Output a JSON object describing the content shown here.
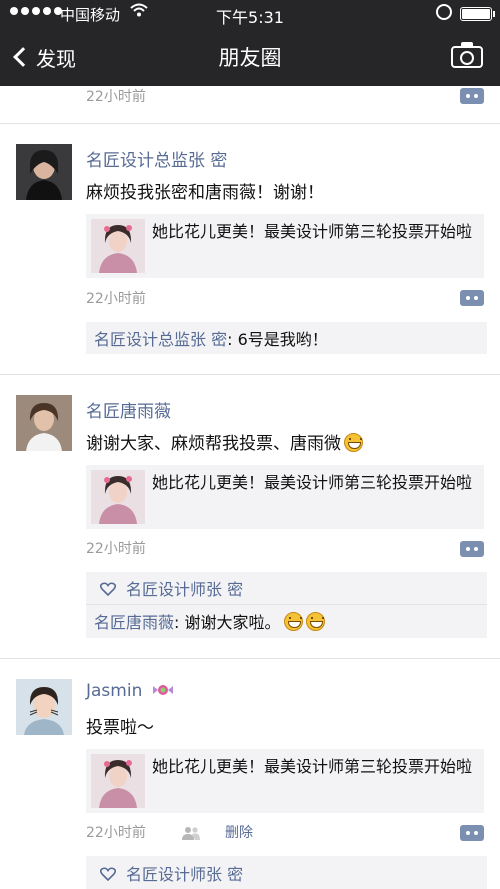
{
  "status_bar": {
    "carrier": "中国移动",
    "time": "下午5:31"
  },
  "nav": {
    "back_label": "发现",
    "title": "朋友圈"
  },
  "top_partial": {
    "time": "22小时前"
  },
  "posts": [
    {
      "author": "名匠设计总监张 密",
      "text": "麻烦投我张密和唐雨薇！谢谢！",
      "share_title": "她比花儿更美！最美设计师第三轮投票开始啦",
      "time": "22小时前",
      "comments": [
        {
          "author": "名匠设计总监张 密",
          "text": ": 6号是我哟！"
        }
      ]
    },
    {
      "author": "名匠唐雨薇",
      "text": "谢谢大家、麻烦帮我投票、唐雨微",
      "share_title": "她比花儿更美！最美设计师第三轮投票开始啦",
      "time": "22小时前",
      "likes": "名匠设计师张 密",
      "comments": [
        {
          "author": "名匠唐雨薇",
          "text": ": 谢谢大家啦。"
        }
      ]
    },
    {
      "author": "Jasmin",
      "text": "投票啦～",
      "share_title": "她比花儿更美！最美设计师第三轮投票开始啦",
      "time": "22小时前",
      "delete_label": "删除",
      "likes": "名匠设计师张 密"
    }
  ],
  "icons": {
    "back": "chevron-left-icon",
    "camera": "camera-icon",
    "comment": "comment-icon",
    "like": "heart-icon",
    "visibility": "people-icon"
  },
  "colors": {
    "link": "#576b95",
    "navbar": "#262628",
    "comment_bg": "#f3f3f5"
  }
}
